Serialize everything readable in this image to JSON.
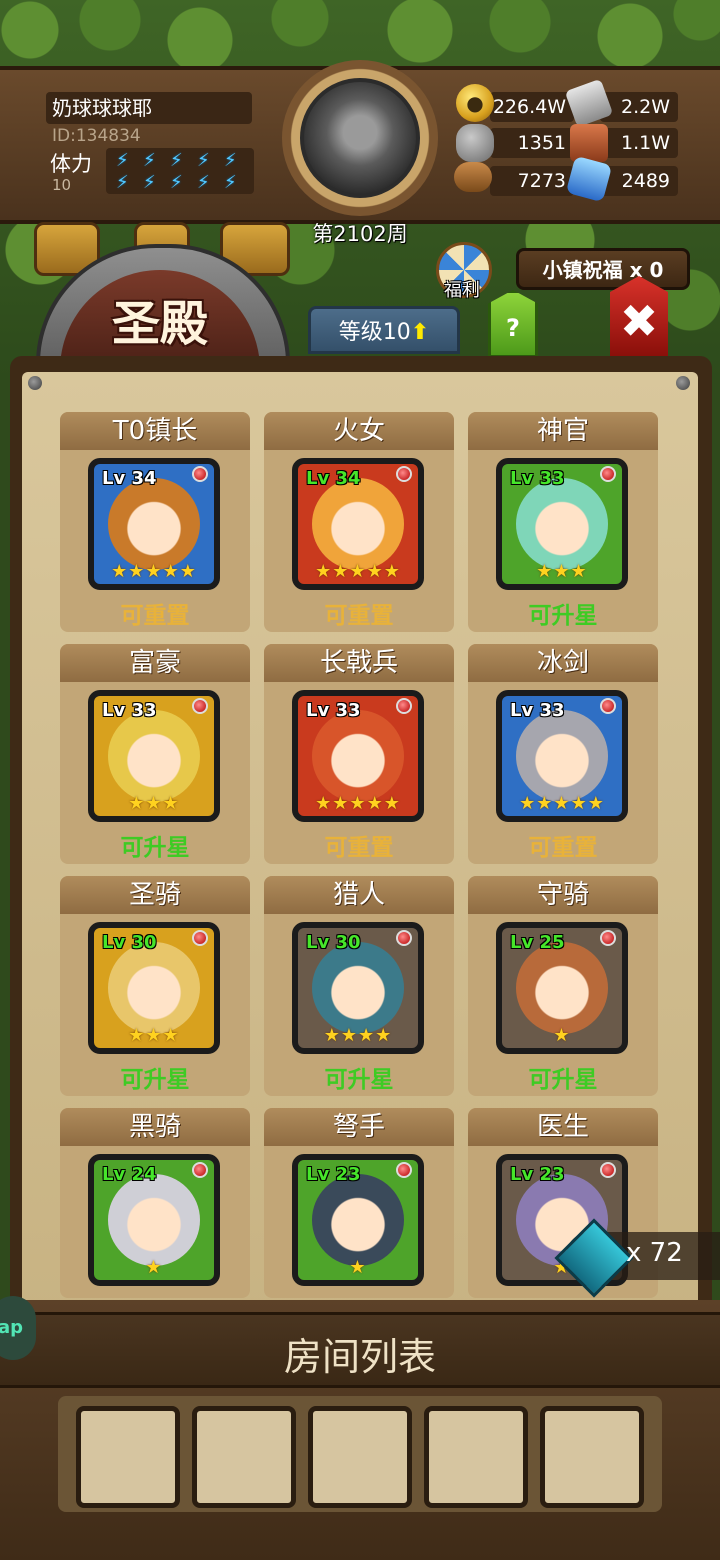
{
  "player": {
    "name": "奶球球球耶",
    "id": "ID:134834",
    "stamina_label": "体力",
    "stamina_value": "10",
    "week": "第2102周"
  },
  "resources": {
    "gold": "226.4W",
    "iron": "2.2W",
    "stone": "1351",
    "leather": "1.1W",
    "wood": "7273",
    "crystal": "2489"
  },
  "temple": {
    "title": "圣殿",
    "level_label": "等级10",
    "welfare_label": "福利",
    "blessing_label": "小镇祝福 x 0",
    "help_label": "?"
  },
  "heroes": [
    {
      "name": "T0镇长",
      "level": "Lv 34",
      "stars": "★★★★★",
      "status": "可重置",
      "status_type": "reset",
      "frame": "#2f6fc4",
      "face": "#c97a2a",
      "lv_color": "white"
    },
    {
      "name": "火女",
      "level": "Lv 34",
      "stars": "★★★★★",
      "status": "可重置",
      "status_type": "reset",
      "frame": "#c93a1e",
      "face": "#f0a43a",
      "lv_color": "green"
    },
    {
      "name": "神官",
      "level": "Lv 33",
      "stars": "★★★",
      "status": "可升星",
      "status_type": "up",
      "frame": "#4ea42a",
      "face": "#7fd6b8",
      "lv_color": "green"
    },
    {
      "name": "富豪",
      "level": "Lv 33",
      "stars": "★★★",
      "status": "可升星",
      "status_type": "up",
      "frame": "#d8a11e",
      "face": "#e7c84a",
      "lv_color": "white"
    },
    {
      "name": "长戟兵",
      "level": "Lv 33",
      "stars": "★★★★★",
      "status": "可重置",
      "status_type": "reset",
      "frame": "#c93a1e",
      "face": "#d8552a",
      "lv_color": "white"
    },
    {
      "name": "冰剑",
      "level": "Lv 33",
      "stars": "★★★★★",
      "status": "可重置",
      "status_type": "reset",
      "frame": "#2f6fc4",
      "face": "#a6a6ae",
      "lv_color": "white"
    },
    {
      "name": "圣骑",
      "level": "Lv 30",
      "stars": "★★★",
      "status": "可升星",
      "status_type": "up",
      "frame": "#d8a11e",
      "face": "#e8c66a",
      "lv_color": "green"
    },
    {
      "name": "猎人",
      "level": "Lv 30",
      "stars": "★★★★",
      "status": "可升星",
      "status_type": "up",
      "frame": "#6a5a4a",
      "face": "#3c7a8a",
      "lv_color": "green"
    },
    {
      "name": "守骑",
      "level": "Lv 25",
      "stars": "★",
      "status": "可升星",
      "status_type": "up",
      "frame": "#6a5a4a",
      "face": "#b86a3a",
      "lv_color": "green"
    },
    {
      "name": "黑骑",
      "level": "Lv 24",
      "stars": "★",
      "status": "",
      "status_type": "up",
      "frame": "#4ea42a",
      "face": "#cfcfd6",
      "lv_color": "green"
    },
    {
      "name": "弩手",
      "level": "Lv 23",
      "stars": "★",
      "status": "",
      "status_type": "up",
      "frame": "#4ea42a",
      "face": "#3a4a5a",
      "lv_color": "green"
    },
    {
      "name": "医生",
      "level": "Lv 23",
      "stars": "★",
      "status": "",
      "status_type": "up",
      "frame": "#6a5a4a",
      "face": "#8a7ab0",
      "lv_color": "green"
    }
  ],
  "gem_badge": {
    "count": "x 72"
  },
  "side_tab": {
    "label": "ap"
  },
  "room_list": {
    "title": "房间列表",
    "slots": 5
  }
}
